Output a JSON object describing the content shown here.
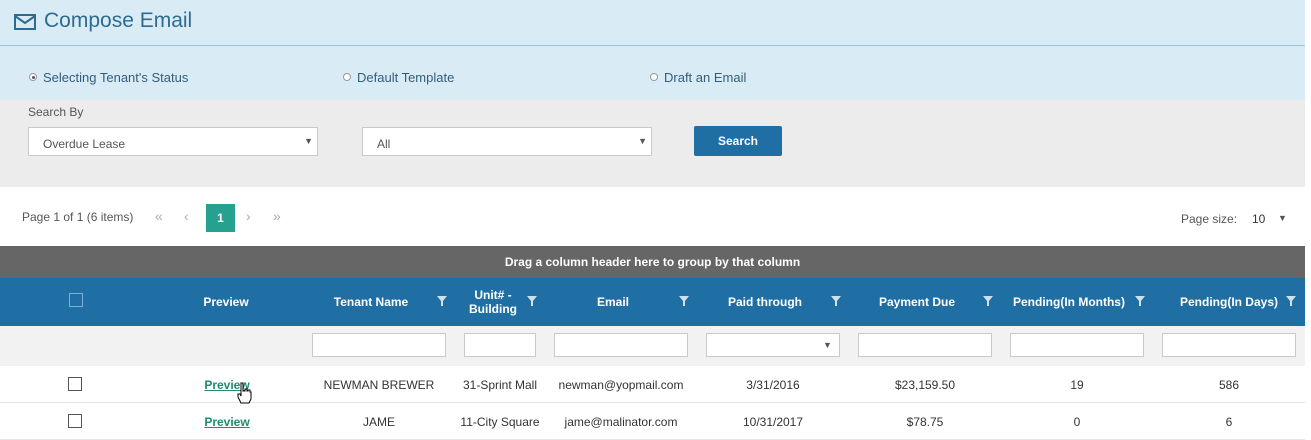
{
  "header": {
    "title": "Compose Email",
    "icon": "envelope-icon"
  },
  "radios": [
    {
      "label": "Selecting Tenant's Status",
      "selected": true
    },
    {
      "label": "Default Template",
      "selected": false
    },
    {
      "label": "Draft an Email",
      "selected": false
    }
  ],
  "search": {
    "label": "Search By",
    "primary_value": "Overdue Lease",
    "secondary_value": "All",
    "button_label": "Search"
  },
  "pager": {
    "summary": "Page 1 of 1 (6 items)",
    "current_page": "1",
    "page_size_label": "Page size:",
    "page_size_value": "10"
  },
  "group_bar": "Drag a column header here to group by that column",
  "columns": {
    "preview": "Preview",
    "tenant_name": "Tenant Name",
    "unit_building": "Unit# - Building",
    "email": "Email",
    "paid_through": "Paid through",
    "payment_due": "Payment Due",
    "pending_months": "Pending(In Months)",
    "pending_days": "Pending(In Days)"
  },
  "rows": [
    {
      "preview": "Preview",
      "tenant_name": "NEWMAN BREWER",
      "unit_building": "31-Sprint Mall",
      "email": "newman@yopmail.com",
      "paid_through": "3/31/2016",
      "payment_due": "$23,159.50",
      "pending_months": "19",
      "pending_days": "586"
    },
    {
      "preview": "Preview",
      "tenant_name": "JAME",
      "unit_building": "11-City Square",
      "email": "jame@malinator.com",
      "paid_through": "10/31/2017",
      "payment_due": "$78.75",
      "pending_months": "0",
      "pending_days": "6"
    }
  ],
  "colors": {
    "accent": "#1f6fa5",
    "header_bg": "#d9ecf6",
    "pager_active": "#26a190",
    "group_bar": "#666666",
    "link": "#1f8a6f"
  }
}
